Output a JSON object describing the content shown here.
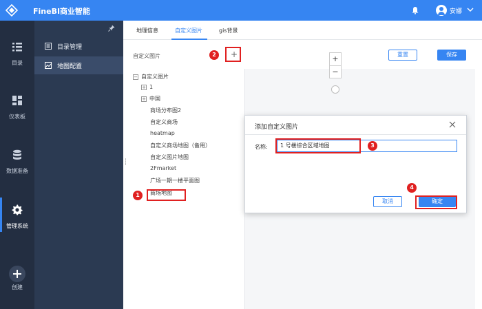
{
  "app": {
    "title": "FineBI商业智能"
  },
  "user": {
    "name": "安娜"
  },
  "left_nav": [
    {
      "label": "目录",
      "icon": "list-icon"
    },
    {
      "label": "仪表板",
      "icon": "dashboard-icon"
    },
    {
      "label": "数据准备",
      "icon": "database-icon"
    },
    {
      "label": "管理系统",
      "icon": "gear-icon"
    },
    {
      "label": "创建",
      "icon": "plus-icon"
    }
  ],
  "sub_nav": [
    {
      "label": "目录管理",
      "icon": "catalog-icon"
    },
    {
      "label": "地图配置",
      "icon": "map-config-icon"
    }
  ],
  "tabs": [
    {
      "label": "地理信息"
    },
    {
      "label": "自定义图片"
    },
    {
      "label": "gis背景"
    }
  ],
  "panel": {
    "title": "自定义图片",
    "add_label": "+",
    "reset_label": "重置",
    "save_label": "保存"
  },
  "tree": {
    "root": "自定义图片",
    "toggle_expanded": "−",
    "toggle_collapsed": "+",
    "items": [
      "1",
      "中国",
      "商场分布图2",
      "自定义商场",
      "heatmap",
      "自定义商场地图（备用）",
      "自定义图片地图",
      "2Fmarket",
      "广场一期一楼平面图",
      "商场地图"
    ]
  },
  "map": {
    "zoom_in": "+",
    "zoom_out": "−"
  },
  "dialog": {
    "title": "添加自定义图片",
    "name_label": "名称:",
    "name_value": "1 号楼综合区域地图",
    "cancel_label": "取消",
    "ok_label": "确定"
  },
  "annotations": [
    "1",
    "2",
    "3",
    "4"
  ],
  "colors": {
    "brand": "#3685f2",
    "nav_dark": "#232e41",
    "subnav": "#2b3a52",
    "annotation": "#e02020"
  }
}
